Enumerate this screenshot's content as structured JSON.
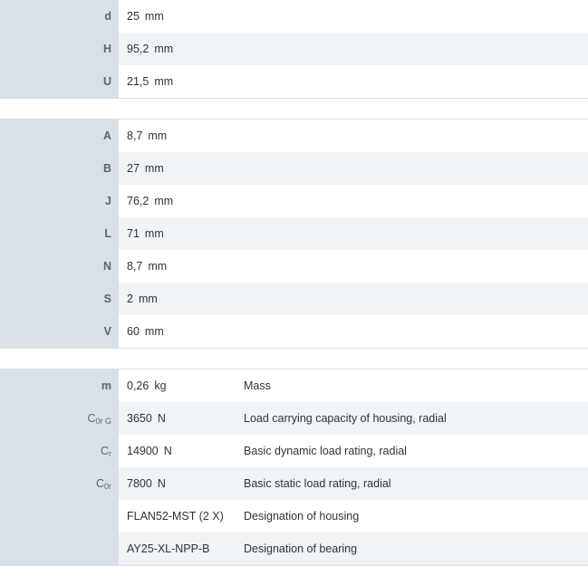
{
  "group1": [
    {
      "sym": "d",
      "value": "25",
      "unit": "mm"
    },
    {
      "sym": "H",
      "value": "95,2",
      "unit": "mm"
    },
    {
      "sym": "U",
      "value": "21,5",
      "unit": "mm"
    }
  ],
  "group2": [
    {
      "sym": "A",
      "value": "8,7",
      "unit": "mm"
    },
    {
      "sym": "B",
      "value": "27",
      "unit": "mm"
    },
    {
      "sym": "J",
      "value": "76,2",
      "unit": "mm"
    },
    {
      "sym": "L",
      "value": "71",
      "unit": "mm"
    },
    {
      "sym": "N",
      "value": "8,7",
      "unit": "mm"
    },
    {
      "sym": "S",
      "value": "2",
      "unit": "mm"
    },
    {
      "sym": "V",
      "value": "60",
      "unit": "mm"
    }
  ],
  "group3": [
    {
      "sym": "m",
      "sub": "",
      "value": "0,26",
      "unit": "kg",
      "desc": "Mass"
    },
    {
      "sym": "C",
      "sub": "0r G",
      "value": "3650",
      "unit": "N",
      "desc": "Load carrying capacity of housing, radial"
    },
    {
      "sym": "C",
      "sub": "r",
      "value": "14900",
      "unit": "N",
      "desc": "Basic dynamic load rating, radial"
    },
    {
      "sym": "C",
      "sub": "0r",
      "value": "7800",
      "unit": "N",
      "desc": "Basic static load rating, radial"
    },
    {
      "sym": "",
      "sub": "",
      "value": "FLAN52-MST (2 X)",
      "unit": "",
      "desc": "Designation of housing"
    },
    {
      "sym": "",
      "sub": "",
      "value": "AY25-XL-NPP-B",
      "unit": "",
      "desc": "Designation of bearing"
    }
  ]
}
